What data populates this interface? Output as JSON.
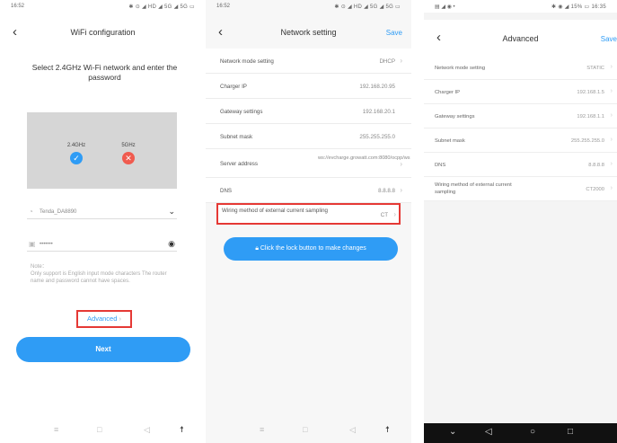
{
  "panel1": {
    "status_time": "16:52",
    "status_icons": "✱ ⊙ ◢ HD ◢ 5G ◢ 5G ▭",
    "title": "WiFi configuration",
    "prompt": "Select 2.4GHz Wi-Fi network and enter the password",
    "band_24": "2.4GHz",
    "band_5": "5GHz",
    "wifi_name": "Tenda_DA8890",
    "password_mask": "•••••••",
    "note": "Note：\nOnly support is English input mode characters The router name and password cannot have spaces.",
    "advanced_label": "Advanced",
    "next_label": "Next"
  },
  "panel2": {
    "status_time": "16:52",
    "status_icons": "✱ ⊙ ◢ HD ◢ 5G ◢ 5G ▭",
    "title": "Network setting",
    "save_label": "Save",
    "rows": [
      {
        "label": "Network mode setting",
        "value": "DHCP"
      },
      {
        "label": "Charger IP",
        "value": "192.168.20.95"
      },
      {
        "label": "Gateway settings",
        "value": "192.168.20.1"
      },
      {
        "label": "Subnet mask",
        "value": "255.255.255.0"
      },
      {
        "label": "Server address",
        "value": "ws://evcharge.growatt.com:8080/ocpp/ws"
      },
      {
        "label": "DNS",
        "value": "8.8.8.8"
      }
    ],
    "wiring_label": "Wiring method of external current sampling",
    "wiring_value": "CT",
    "lock_button": "Click the lock button to make changes"
  },
  "panel3": {
    "status_left": "▤ ◢ ◉ •",
    "status_right": "✱ ◉ ◢ 15% ▭ 16:35",
    "title": "Advanced",
    "save_label": "Save",
    "rows": [
      {
        "label": "Network mode setting",
        "value": "STATIC"
      },
      {
        "label": "Charger IP",
        "value": "192.168.1.5"
      },
      {
        "label": "Gateway settings",
        "value": "192.168.1.1"
      },
      {
        "label": "Subnet mask",
        "value": "255.255.255.0"
      },
      {
        "label": "DNS",
        "value": "8.8.8.8"
      },
      {
        "label": "Wiring method of external current sampling",
        "value": "CT2000"
      }
    ]
  }
}
